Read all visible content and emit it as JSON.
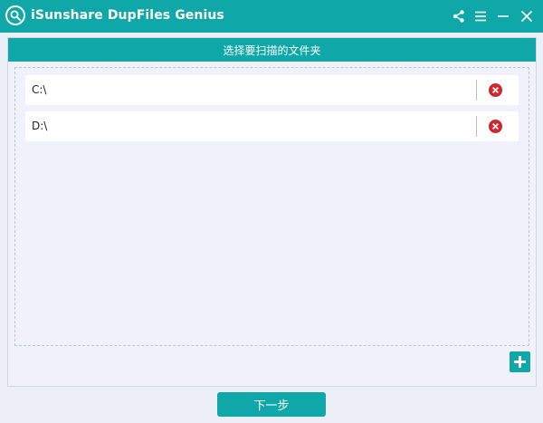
{
  "app": {
    "title": "iSunshare DupFiles Genius",
    "logo_icon": "magnifier-logo-icon"
  },
  "titlebar": {
    "buttons": [
      "share-icon",
      "menu-icon",
      "minimize-icon",
      "close-icon"
    ]
  },
  "section": {
    "header": "选择要扫描的文件夹"
  },
  "folders": [
    {
      "path": "C:\\"
    },
    {
      "path": "D:\\"
    }
  ],
  "actions": {
    "next_label": "下一步",
    "add_icon": "plus-icon",
    "remove_icon": "remove-circle-icon"
  },
  "colors": {
    "accent": "#10a7a8",
    "remove": "#d9262c",
    "background": "#f0f1fb"
  }
}
